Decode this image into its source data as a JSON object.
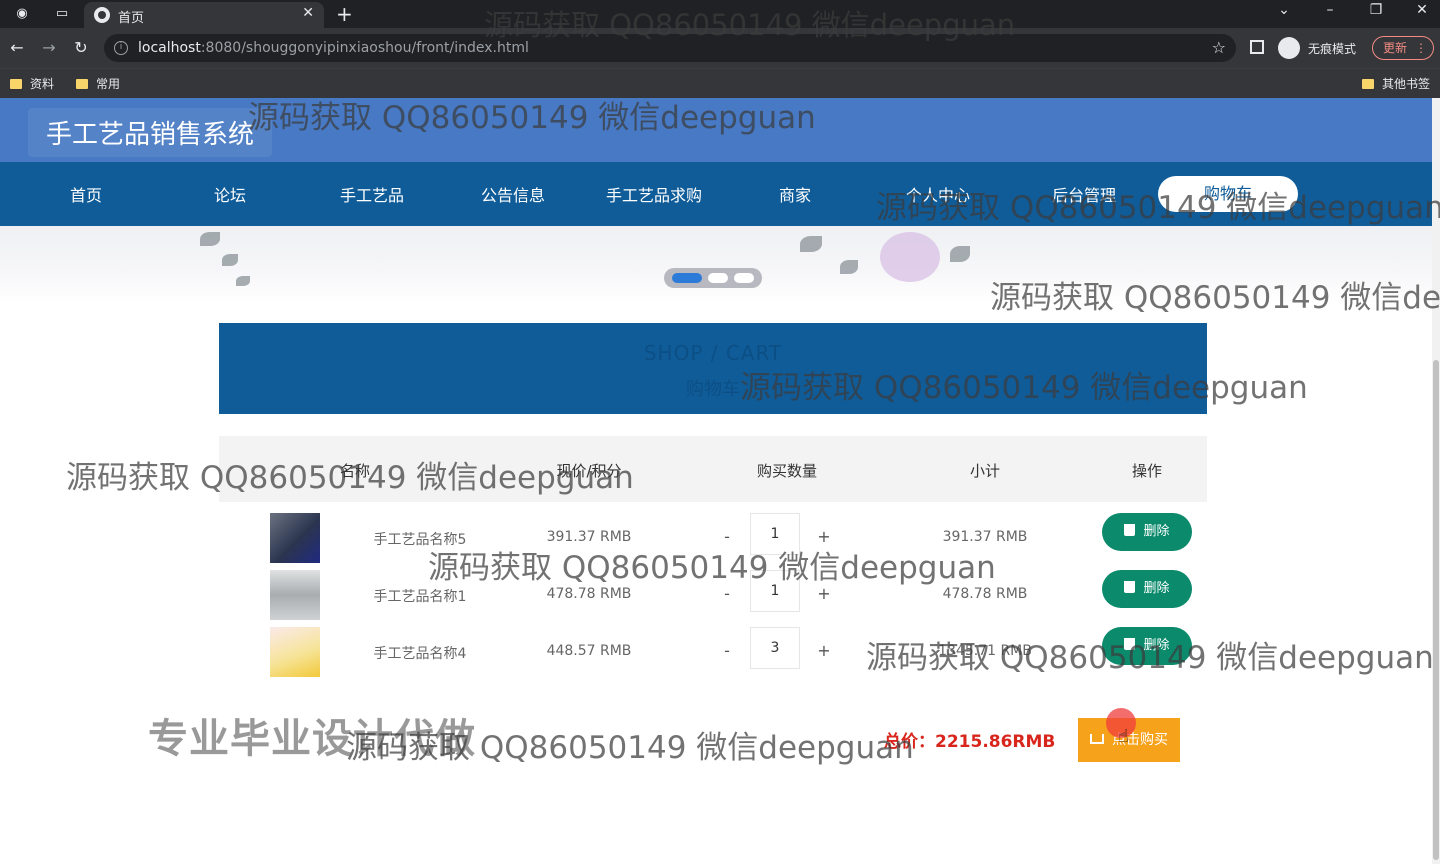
{
  "browser": {
    "tab_title": "首页",
    "url_host": "localhost",
    "url_rest": ":8080/shouggonyipinxiaoshou/front/index.html",
    "incognito_label": "无痕模式",
    "update_label": "更新",
    "bookmarks": [
      "资料",
      "常用"
    ],
    "other_bookmarks": "其他书签"
  },
  "site": {
    "title": "手工艺品销售系统",
    "nav": [
      "首页",
      "论坛",
      "手工艺品",
      "公告信息",
      "手工艺品求购",
      "商家",
      "个人中心",
      "后台管理",
      "购物车"
    ]
  },
  "cart": {
    "heading_en": "SHOP / CART",
    "heading_cn": "购物车",
    "columns": [
      "名称",
      "现价/积分",
      "购买数量",
      "小计",
      "操作"
    ],
    "items": [
      {
        "name": "手工艺品名称5",
        "price": "391.37 RMB",
        "qty": "1",
        "subtotal": "391.37 RMB",
        "thumb_color": "#2b3550"
      },
      {
        "name": "手工艺品名称1",
        "price": "478.78 RMB",
        "qty": "1",
        "subtotal": "478.78 RMB",
        "thumb_color": "#a9adb0"
      },
      {
        "name": "手工艺品名称4",
        "price": "448.57 RMB",
        "qty": "3",
        "subtotal": "1345.71 RMB",
        "thumb_color": "#f6e49a"
      }
    ],
    "minus": "-",
    "plus": "+",
    "delete_label": "删除",
    "total_label": "总价：2215.86RMB",
    "buy_label": "点击购买"
  },
  "watermarks": {
    "text": "源码获取 QQ86050149 微信deepguan",
    "promo": "专业毕业设计代做"
  },
  "colors": {
    "header": "#4779c4",
    "nav": "#0f5c99",
    "delete": "#0b8a6c",
    "buy": "#f7a21b",
    "total": "#d9261c"
  }
}
